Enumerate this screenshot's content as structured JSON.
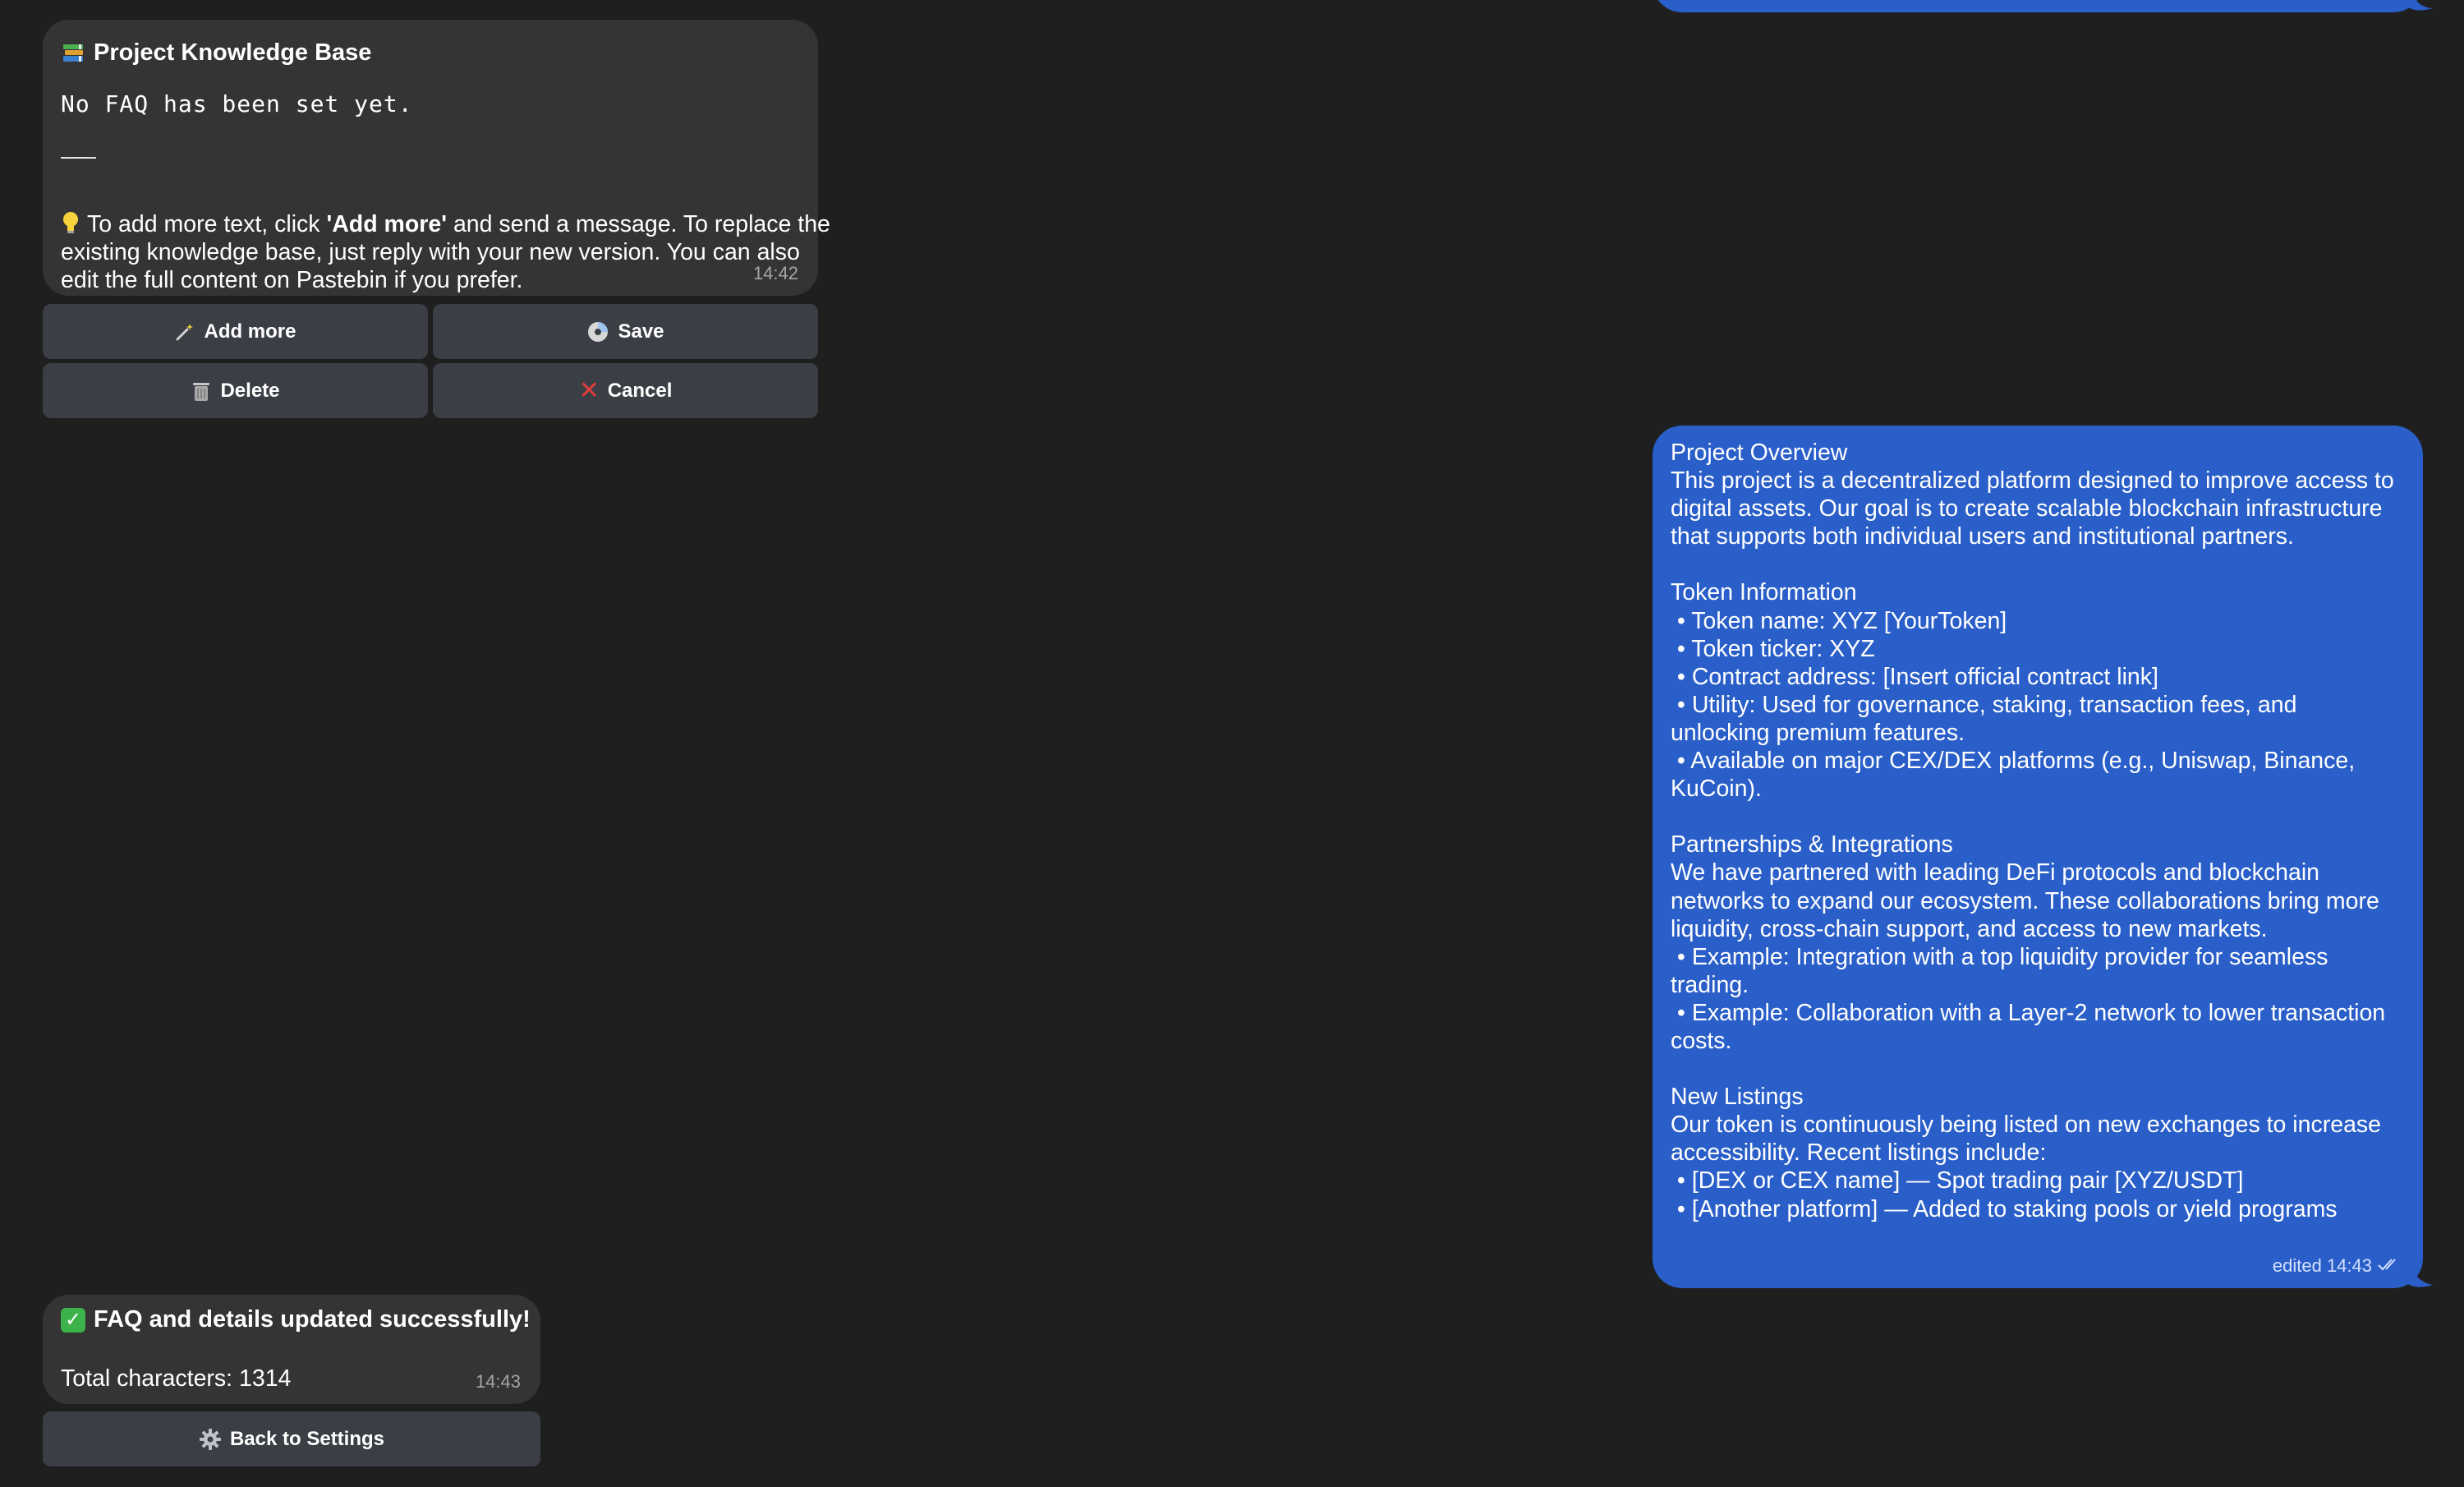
{
  "knowledge_base_message": {
    "title": "Project Knowledge Base",
    "title_icon": "books-icon",
    "no_faq": "No FAQ has been set yet.",
    "separator": "———",
    "hint_icon": "lightbulb-icon",
    "hint_before": "To add more text, click ",
    "hint_bold": "'Add more'",
    "hint_after": " and send a message. To replace the existing knowledge base, just reply with your new version. You can also edit the full content on Pastebin if you prefer.",
    "time": "14:42"
  },
  "kb_buttons": {
    "add_more": "Add more",
    "save": "Save",
    "delete": "Delete",
    "cancel": "Cancel"
  },
  "outgoing_message": {
    "text": "Project Overview\nThis project is a decentralized platform designed to improve access to digital assets. Our goal is to create scalable blockchain infrastructure that supports both individual users and institutional partners.\n\nToken Information\n • Token name: XYZ [YourToken]\n • Token ticker: XYZ\n • Contract address: [Insert official contract link]\n • Utility: Used for governance, staking, transaction fees, and unlocking premium features.\n • Available on major CEX/DEX platforms (e.g., Uniswap, Binance, KuCoin).\n\nPartnerships & Integrations\nWe have partnered with leading DeFi protocols and blockchain networks to expand our ecosystem. These collaborations bring more liquidity, cross-chain support, and access to new markets.\n • Example: Integration with a top liquidity provider for seamless trading.\n • Example: Collaboration with a Layer-2 network to lower transaction costs.\n\nNew Listings\nOur token is continuously being listed on new exchanges to increase accessibility. Recent listings include:\n • [DEX or CEX name] — Spot trading pair [XYZ/USDT]\n • [Another platform] — Added to staking pools or yield programs",
    "status": "edited 14:43"
  },
  "success_message": {
    "title": "FAQ and details updated successfully!",
    "body": "Total characters: 1314",
    "time": "14:43"
  },
  "settings_button": {
    "label": "Back to Settings"
  },
  "colors": {
    "background": "#1f1f1f",
    "incoming_bubble": "#343434",
    "outgoing_bubble": "#2a5fc9",
    "button": "#3b3f45"
  }
}
